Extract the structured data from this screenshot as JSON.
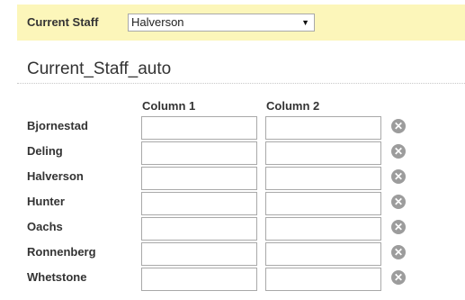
{
  "topbar": {
    "label": "Current Staff",
    "selected": "Halverson",
    "arrow": "▼"
  },
  "section": {
    "title": "Current_Staff_auto"
  },
  "columns": [
    "Column 1",
    "Column 2"
  ],
  "rows": [
    {
      "label": "Bjornestad",
      "col1": "",
      "col2": ""
    },
    {
      "label": "Deling",
      "col1": "",
      "col2": ""
    },
    {
      "label": "Halverson",
      "col1": "",
      "col2": ""
    },
    {
      "label": "Hunter",
      "col1": "",
      "col2": ""
    },
    {
      "label": "Oachs",
      "col1": "",
      "col2": ""
    },
    {
      "label": "Ronnenberg",
      "col1": "",
      "col2": ""
    },
    {
      "label": "Whetstone",
      "col1": "",
      "col2": ""
    }
  ],
  "icons": {
    "remove": "remove-circle-icon",
    "remove_glyph": "✕"
  },
  "colors": {
    "topbar_bg": "#fcf6ba",
    "remove_icon": "#9c9c9c"
  }
}
